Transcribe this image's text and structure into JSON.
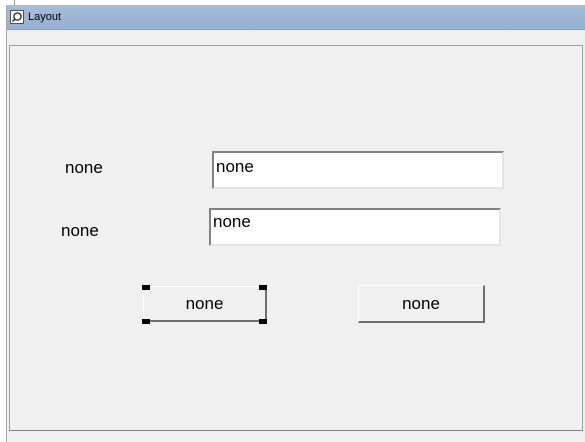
{
  "window": {
    "title": "Layout",
    "icon": "app-icon"
  },
  "form": {
    "label_1": "none",
    "label_2": "none",
    "field_1_value": "none",
    "field_2_value": "none",
    "button_left_label": "none",
    "button_right_label": "none"
  },
  "colors": {
    "titlebar": "#a6bcd8",
    "window_bg": "#f0f0f0"
  }
}
